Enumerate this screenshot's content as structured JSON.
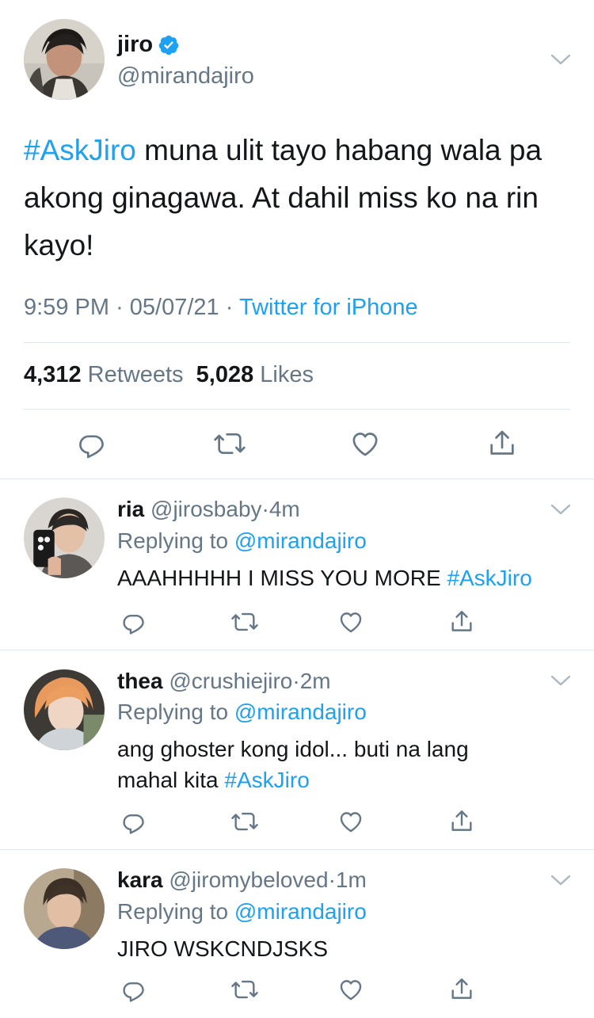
{
  "main_tweet": {
    "author_name": "jiro",
    "author_handle": "@mirandajiro",
    "text_hashtag": "#AskJiro",
    "text_body": " muna ulit tayo habang wala pa akong ginagawa. At dahil miss ko na rin kayo!",
    "time": "9:59 PM",
    "date": "05/07/21",
    "source": "Twitter for iPhone",
    "retweets_count": "4,312",
    "retweets_label": "Retweets",
    "likes_count": "5,028",
    "likes_label": "Likes"
  },
  "replies": [
    {
      "name": "ria",
      "handle": "@jirosbaby",
      "time": "4m",
      "replying_prefix": "Replying to",
      "replying_to": "@mirandajiro",
      "text": "AAAHHHHH I MISS YOU MORE ",
      "hashtag": "#AskJiro"
    },
    {
      "name": "thea",
      "handle": "@crushiejiro",
      "time": "2m",
      "replying_prefix": "Replying to",
      "replying_to": "@mirandajiro",
      "text": "ang ghoster kong idol... buti na lang mahal kita ",
      "hashtag": "#AskJiro"
    },
    {
      "name": "kara",
      "handle": "@jiromybeloved",
      "time": "1m",
      "replying_prefix": "Replying to",
      "replying_to": "@mirandajiro",
      "text": "JIRO WSKCNDJSKS",
      "hashtag": ""
    }
  ],
  "separator_dot": "·",
  "icons": [
    "verified-badge-icon",
    "chevron-down-icon",
    "reply-icon",
    "retweet-icon",
    "like-icon",
    "share-icon"
  ],
  "colors": {
    "link": "#1da1f2",
    "secondary_text": "#657786",
    "primary_text": "#14171a",
    "divider": "#e1e8ed"
  }
}
